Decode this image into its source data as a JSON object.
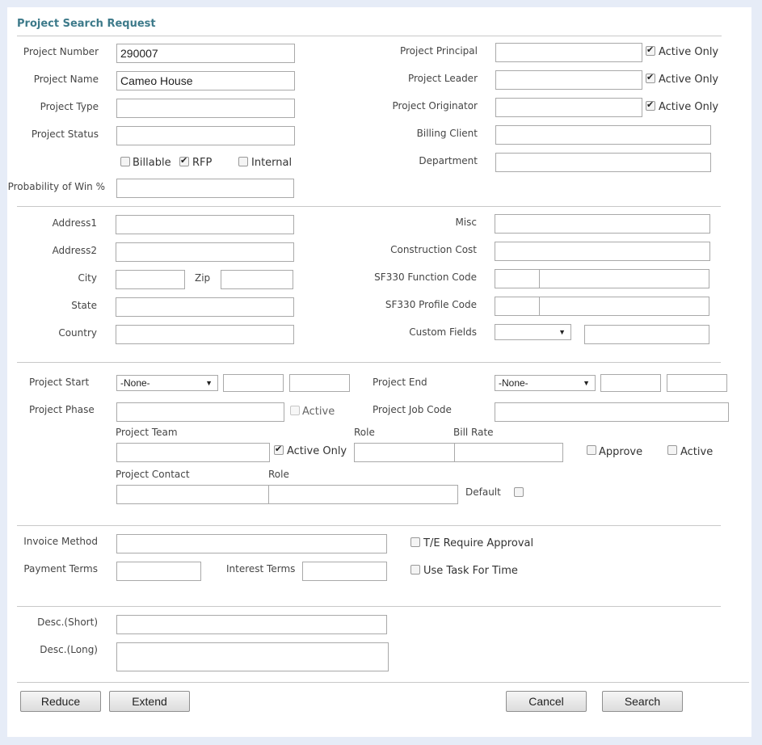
{
  "title": "Project Search Request",
  "general": {
    "project_number_label": "Project Number",
    "project_number_value": "290007",
    "project_name_label": "Project Name",
    "project_name_value": "Cameo House",
    "project_type_label": "Project Type",
    "project_status_label": "Project Status",
    "billable_label": "Billable",
    "rfp_label": "RFP",
    "internal_label": "Internal",
    "probability_label": "Probability of Win %",
    "project_principal_label": "Project Principal",
    "project_leader_label": "Project Leader",
    "project_originator_label": "Project Originator",
    "active_only_label": "Active Only",
    "billing_client_label": "Billing Client",
    "department_label": "Department"
  },
  "address": {
    "address1_label": "Address1",
    "address2_label": "Address2",
    "city_label": "City",
    "zip_label": "Zip",
    "state_label": "State",
    "country_label": "Country",
    "misc_label": "Misc",
    "construction_cost_label": "Construction Cost",
    "sf330_function_label": "SF330 Function Code",
    "sf330_profile_label": "SF330 Profile Code",
    "custom_fields_label": "Custom Fields"
  },
  "schedule": {
    "project_start_label": "Project Start",
    "project_end_label": "Project End",
    "none_option": "-None-",
    "project_phase_label": "Project Phase",
    "active_label": "Active",
    "project_job_code_label": "Project Job Code",
    "project_team_label": "Project Team",
    "role_label": "Role",
    "bill_rate_label": "Bill Rate",
    "active_only_label": "Active Only",
    "approve_label": "Approve",
    "project_contact_label": "Project Contact",
    "default_label": "Default"
  },
  "billing": {
    "invoice_method_label": "Invoice Method",
    "te_require_approval_label": "T/E Require Approval",
    "payment_terms_label": "Payment Terms",
    "interest_terms_label": "Interest Terms",
    "use_task_for_time_label": "Use Task For Time"
  },
  "description": {
    "short_label": "Desc.(Short)",
    "long_label": "Desc.(Long)"
  },
  "buttons": {
    "reduce": "Reduce",
    "extend": "Extend",
    "cancel": "Cancel",
    "search": "Search"
  }
}
